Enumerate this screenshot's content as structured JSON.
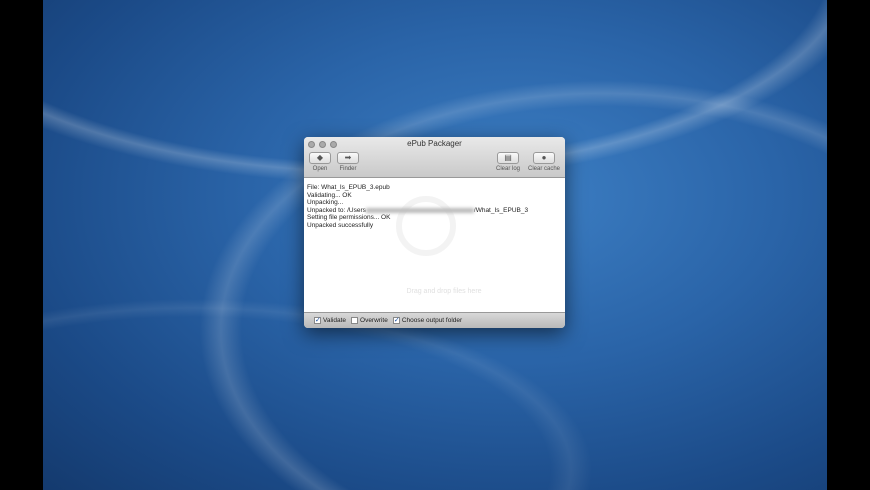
{
  "window": {
    "title": "ePub Packager"
  },
  "toolbar": {
    "open": "Open",
    "finder": "Finder",
    "clear_log": "Clear log",
    "clear_cache": "Clear cache"
  },
  "log": {
    "lines": [
      "File: What_Is_EPUB_3.epub",
      "Validating... OK",
      "Unpacking...",
      "Setting file permissions... OK",
      "Unpacked successfully"
    ],
    "unpacked_prefix": "Unpacked to: /Users",
    "unpacked_suffix": "/What_Is_EPUB_3"
  },
  "drop_hint": "Drag and drop files here",
  "options": [
    {
      "label": "Validate",
      "checked": true
    },
    {
      "label": "Overwrite",
      "checked": false
    },
    {
      "label": "Choose output folder",
      "checked": true
    }
  ]
}
